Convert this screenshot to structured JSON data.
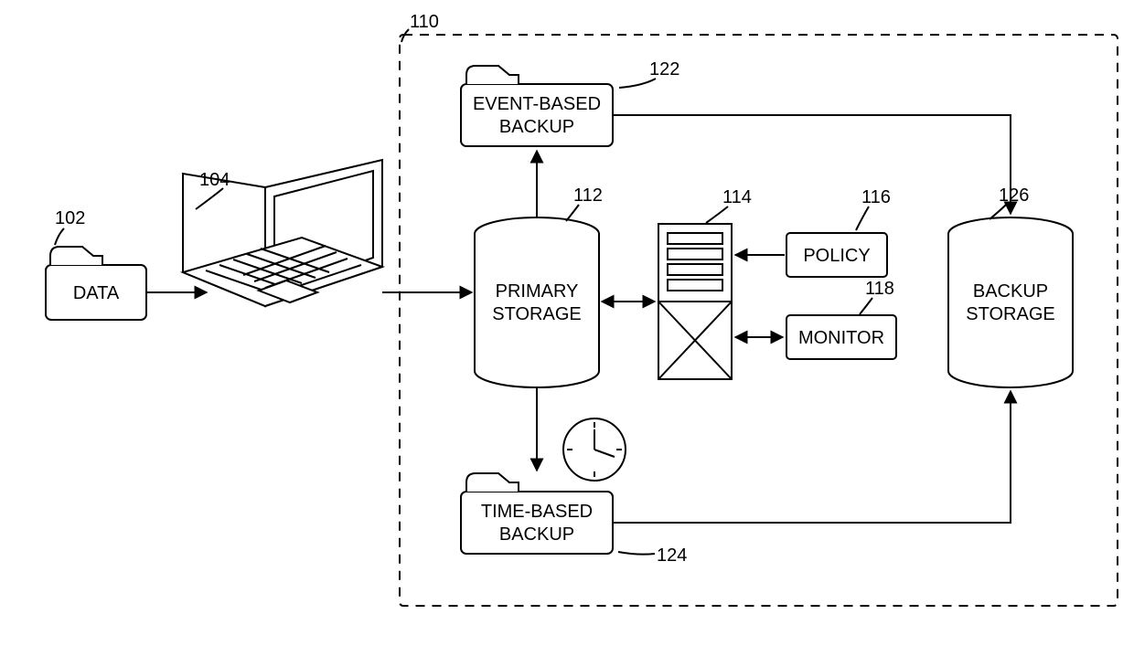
{
  "refs": {
    "data": "102",
    "laptop": "104",
    "system": "110",
    "primary_storage": "112",
    "server": "114",
    "policy": "116",
    "monitor": "118",
    "event_backup": "122",
    "time_backup": "124",
    "backup_storage": "126"
  },
  "labels": {
    "data": "DATA",
    "primary_storage_l1": "PRIMARY",
    "primary_storage_l2": "STORAGE",
    "event_backup_l1": "EVENT-BASED",
    "event_backup_l2": "BACKUP",
    "time_backup_l1": "TIME-BASED",
    "time_backup_l2": "BACKUP",
    "policy": "POLICY",
    "monitor": "MONITOR",
    "backup_storage_l1": "BACKUP",
    "backup_storage_l2": "STORAGE"
  }
}
